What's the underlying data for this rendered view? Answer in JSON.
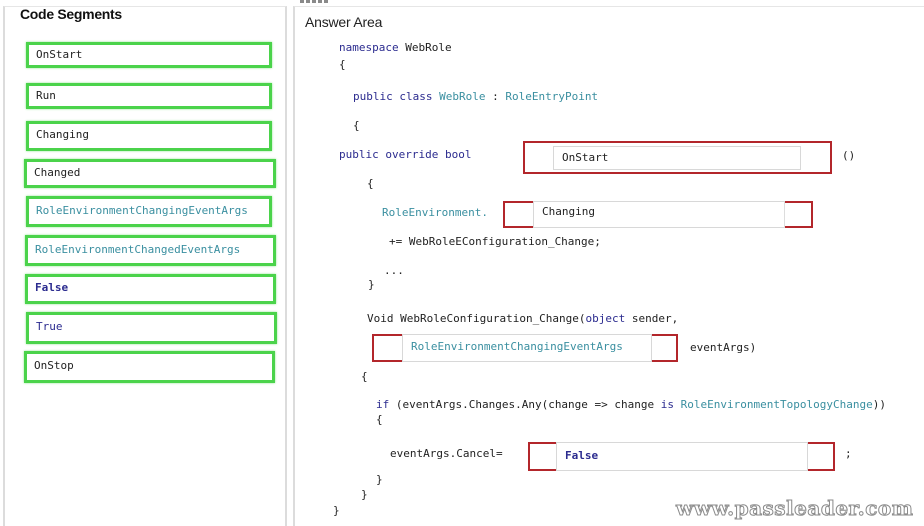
{
  "left_panel": {
    "title": "Code Segments",
    "segments": [
      {
        "label": "OnStart",
        "kind": "plain"
      },
      {
        "label": "Run",
        "kind": "plain"
      },
      {
        "label": "Changing",
        "kind": "plain"
      },
      {
        "label": "Changed",
        "kind": "plain"
      },
      {
        "label": "RoleEnvironmentChangingEventArgs",
        "kind": "type"
      },
      {
        "label": "RoleEnvironmentChangedEventArgs",
        "kind": "type"
      },
      {
        "label": "False",
        "kind": "keyword"
      },
      {
        "label": "True",
        "kind": "keyword"
      },
      {
        "label": "OnStop",
        "kind": "plain"
      }
    ]
  },
  "right_panel": {
    "title": "Answer Area",
    "code": {
      "l1_kw": "namespace",
      "l1_rest": " WebRole",
      "l2": "{",
      "l3_kw": "public class",
      "l3_type1": "WebRole",
      "l3_sep": " : ",
      "l3_type2": "RoleEntryPoint",
      "l4": "{",
      "l5_kw": "public override bool",
      "l5_tail": "()",
      "l6": "{",
      "l7_type": "RoleEnvironment.",
      "l8": "+= WebRoleEConfiguration_Change;",
      "l9": "...",
      "l10": "}",
      "l11_pre": "Void WebRoleConfiguration_Change(",
      "l11_kw": "object",
      "l11_post": " sender,",
      "l12_tail": "eventArgs)",
      "l13": "{",
      "l14_kw1": "if",
      "l14_mid": " (eventArgs.Changes.Any(change => change ",
      "l14_kw2": "is",
      "l14_type": "RoleEnvironmentTopologyChange",
      "l14_end": "))",
      "l15": "{",
      "l16_pre": "eventArgs.Cancel=",
      "l16_tail": ";",
      "l17": "}",
      "l18": "}",
      "l19": "}"
    },
    "targets": {
      "method_name": "OnStart",
      "event_name": "Changing",
      "args_type": "RoleEnvironmentChangingEventArgs",
      "cancel_value": "False"
    }
  },
  "watermark": "www.passleader.com",
  "colors": {
    "source_border": "#4bd34b",
    "target_border": "#b3262b",
    "keyword": "#2b2b8f",
    "type": "#3a8fa0"
  }
}
